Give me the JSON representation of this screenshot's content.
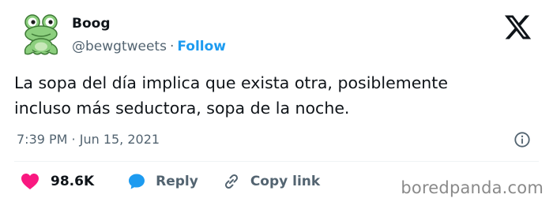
{
  "author": {
    "name": "Boog",
    "handle": "@bewgtweets",
    "separator": "·",
    "follow_label": "Follow",
    "avatar_icon": "frog-avatar-icon"
  },
  "platform_icon": "x-logo-icon",
  "tweet": {
    "text": "La sopa del día implica que exista otra, posiblemente\nincluso más seductora, sopa de la noche.",
    "time": "7:39 PM · Jun 15, 2021"
  },
  "actions": {
    "like_count": "98.6K",
    "reply_label": "Reply",
    "copy_label": "Copy link"
  },
  "colors": {
    "like": "#f91880",
    "accent": "#1d9bf0",
    "muted": "#536471",
    "text": "#0f1419"
  },
  "watermark": "boredpanda.com"
}
